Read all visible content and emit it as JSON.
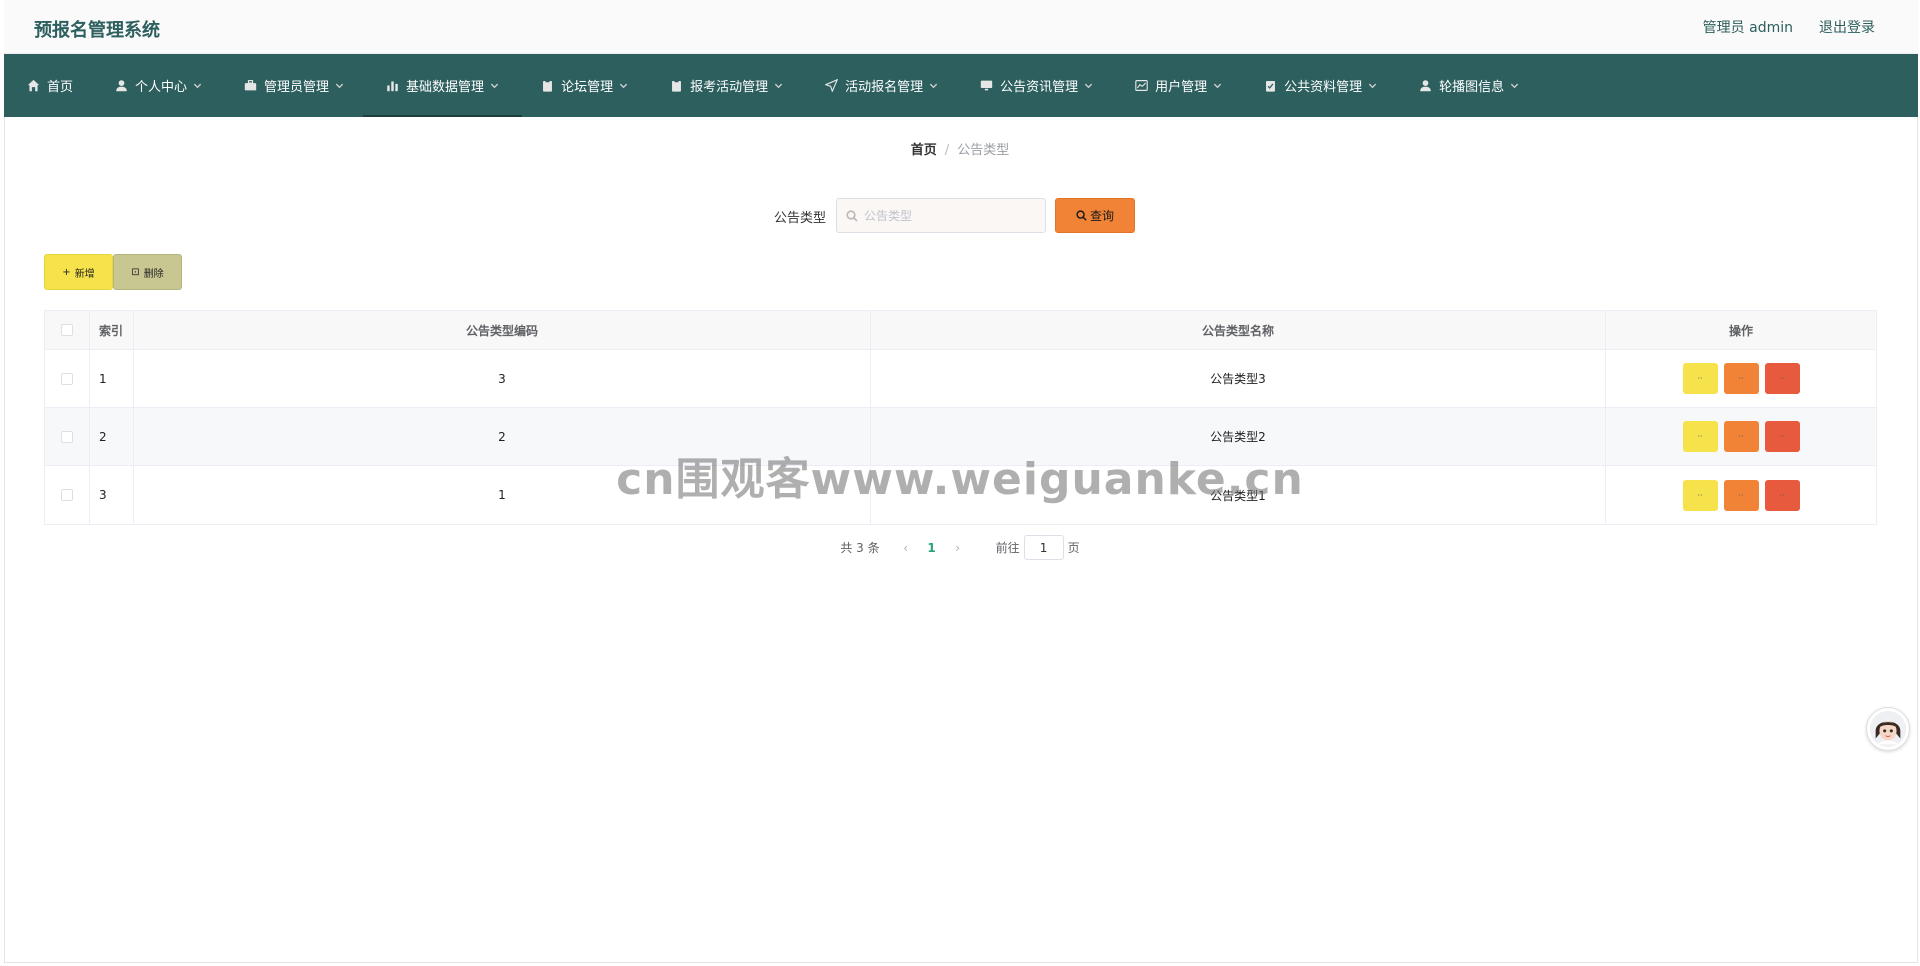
{
  "header": {
    "title": "预报名管理系统",
    "user": "管理员 admin",
    "logout": "退出登录"
  },
  "nav": {
    "items": [
      {
        "label": "首页",
        "icon": "home-icon",
        "dropdown": false
      },
      {
        "label": "个人中心",
        "icon": "user-icon",
        "dropdown": true
      },
      {
        "label": "管理员管理",
        "icon": "briefcase-icon",
        "dropdown": true
      },
      {
        "label": "基础数据管理",
        "icon": "bar-chart-icon",
        "dropdown": true,
        "active": true
      },
      {
        "label": "论坛管理",
        "icon": "clipboard-icon",
        "dropdown": true
      },
      {
        "label": "报考活动管理",
        "icon": "clipboard-icon",
        "dropdown": true
      },
      {
        "label": "活动报名管理",
        "icon": "send-icon",
        "dropdown": true
      },
      {
        "label": "公告资讯管理",
        "icon": "monitor-icon",
        "dropdown": true
      },
      {
        "label": "用户管理",
        "icon": "chart-window-icon",
        "dropdown": true
      },
      {
        "label": "公共资料管理",
        "icon": "checklist-icon",
        "dropdown": true
      },
      {
        "label": "轮播图信息",
        "icon": "user-icon",
        "dropdown": true
      }
    ]
  },
  "breadcrumb": {
    "home": "首页",
    "separator": "/",
    "current": "公告类型"
  },
  "search": {
    "label": "公告类型",
    "placeholder": "公告类型",
    "button": "查询"
  },
  "actions": {
    "add": "新增",
    "delete": "删除"
  },
  "table": {
    "headers": [
      "索引",
      "公告类型编码",
      "公告类型名称",
      "操作"
    ],
    "rows": [
      {
        "index": "1",
        "code": "3",
        "name": "公告类型3"
      },
      {
        "index": "2",
        "code": "2",
        "name": "公告类型2"
      },
      {
        "index": "3",
        "code": "1",
        "name": "公告类型1"
      }
    ]
  },
  "pagination": {
    "total": "共 3 条",
    "current_page": "1",
    "goto_label": "前往",
    "goto_value": "1",
    "page_suffix": "页"
  },
  "watermark": "cn围观客www.weiguanke.cn",
  "colors": {
    "nav_bg": "#2c5f5d",
    "brand": "#2c5f5d",
    "search_button": "#f08336",
    "add_button": "#f6e34c",
    "delete_button": "#c8c691",
    "op_yellow": "#f6e34c",
    "op_orange": "#f08336",
    "op_red": "#e85a3e",
    "page_active": "#2aa37f"
  }
}
